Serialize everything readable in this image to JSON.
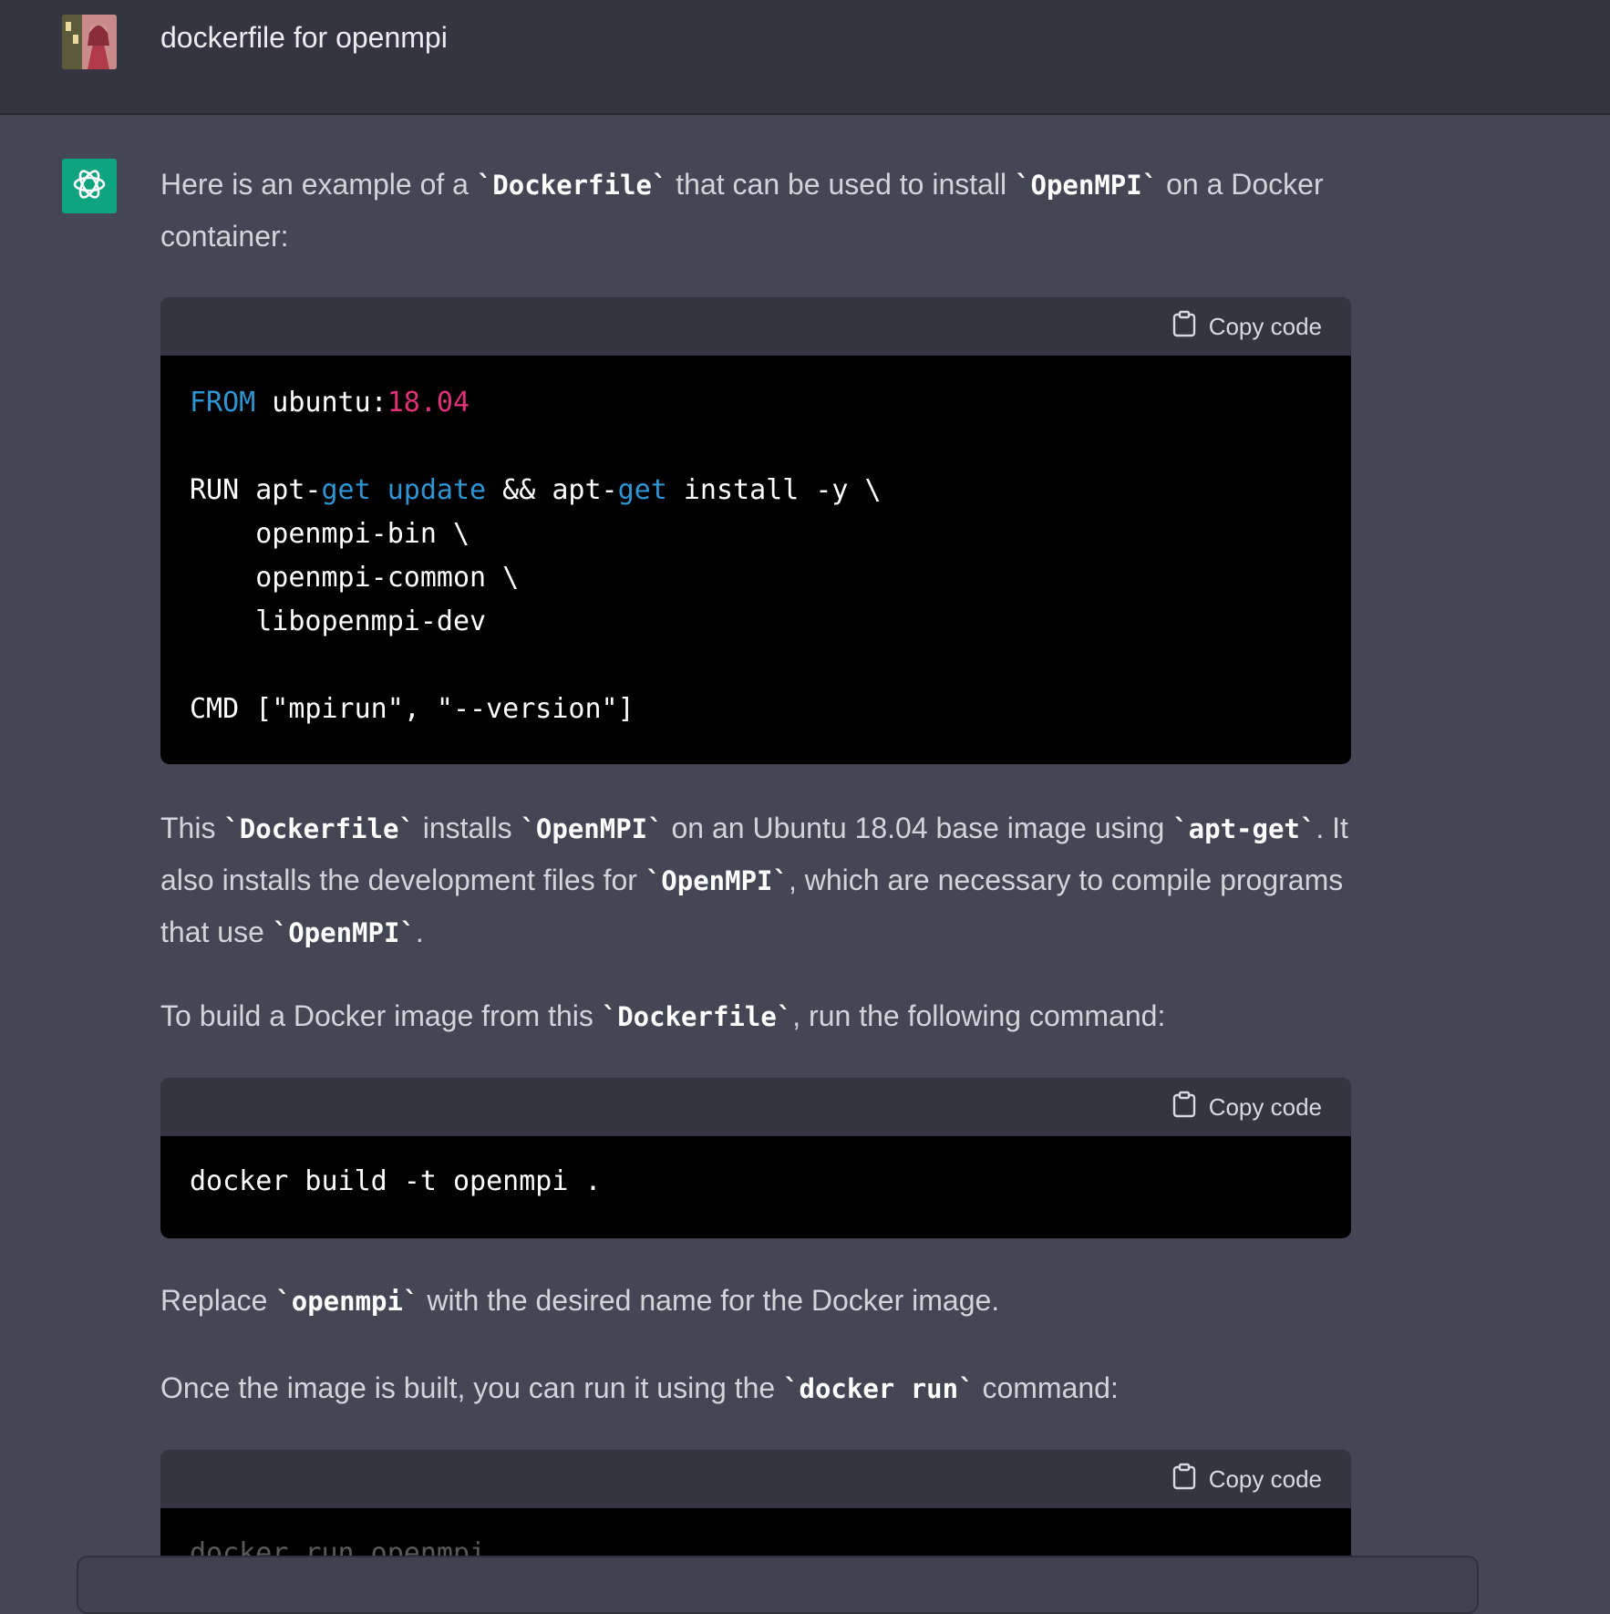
{
  "user_message": {
    "text": "dockerfile for openmpi"
  },
  "assistant": {
    "p1": {
      "t1": "Here is an example of a ",
      "c1": "`Dockerfile`",
      "t2": " that can be used to install ",
      "c2": "`OpenMPI`",
      "t3": " on a Docker container:"
    },
    "code1": {
      "copy_label": "Copy code",
      "l1_kw": "FROM",
      "l1_text": " ubuntu:",
      "l1_num": "18.04",
      "l3_a": "RUN apt-",
      "l3_kw1": "get",
      "l3_sp": " ",
      "l3_kw2": "update",
      "l3_b": " && apt-",
      "l3_kw3": "get",
      "l3_c": " install -y \\",
      "l4": "    openmpi-bin \\",
      "l5": "    openmpi-common \\",
      "l6": "    libopenmpi-dev",
      "l8": "CMD [\"mpirun\", \"--version\"]"
    },
    "p2": {
      "t1": "This ",
      "c1": "`Dockerfile`",
      "t2": " installs ",
      "c2": "`OpenMPI`",
      "t3": " on an Ubuntu 18.04 base image using ",
      "c3": "`apt-get`",
      "t4": ". It also installs the development files for ",
      "c4": "`OpenMPI`",
      "t5": ", which are necessary to compile programs that use ",
      "c5": "`OpenMPI`",
      "t6": "."
    },
    "p3": {
      "t1": "To build a Docker image from this ",
      "c1": "`Dockerfile`",
      "t2": ", run the following command:"
    },
    "code2": {
      "copy_label": "Copy code",
      "line": "docker build -t openmpi ."
    },
    "p4": {
      "t1": "Replace ",
      "c1": "`openmpi`",
      "t2": " with the desired name for the Docker image."
    },
    "p5": {
      "t1": "Once the image is built, you can run it using the ",
      "c1": "`docker run`",
      "t2": " command:"
    },
    "code3": {
      "copy_label": "Copy code",
      "line": "docker run openmpi"
    }
  },
  "colors": {
    "keyword": "#2e95d3",
    "number": "#df3079",
    "bot_avatar": "#10a37f"
  },
  "icons": {
    "copy": "clipboard-icon",
    "bot": "openai-logo-icon"
  }
}
